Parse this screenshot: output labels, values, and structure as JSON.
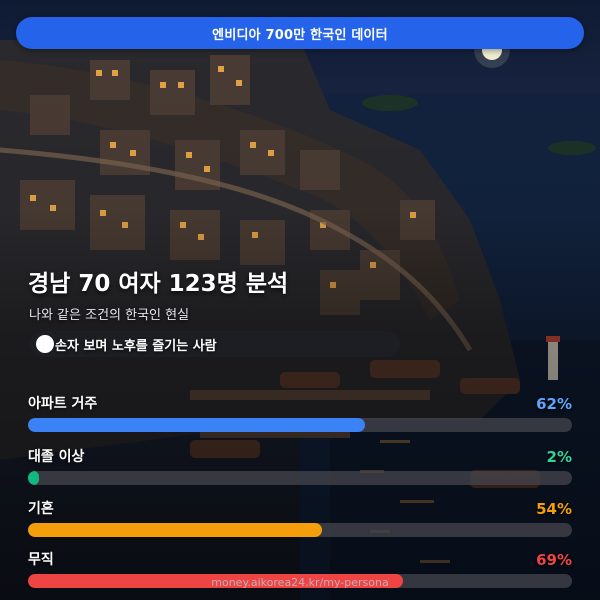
{
  "banner": {
    "text": "엔비디아 700만 한국인 데이터"
  },
  "headline": "경남 70 여자 123명 분석",
  "subtitle": "나와 같은 조건의 한국인 현실",
  "persona": {
    "label": "손자 보며 노후를 즐기는 사람"
  },
  "stats": [
    {
      "label": "아파트 거주",
      "value_text": "62%",
      "value": 62,
      "color": "#3b82f6",
      "text_color": "#60a5fa"
    },
    {
      "label": "대졸 이상",
      "value_text": "2%",
      "value": 2,
      "color": "#10b981",
      "text_color": "#34d399"
    },
    {
      "label": "기혼",
      "value_text": "54%",
      "value": 54,
      "color": "#f59e0b",
      "text_color": "#f59e0b"
    },
    {
      "label": "무직",
      "value_text": "69%",
      "value": 69,
      "color": "#ef4444",
      "text_color": "#ef4444"
    }
  ],
  "footer": {
    "url": "money.aikorea24.kr/my-persona"
  }
}
